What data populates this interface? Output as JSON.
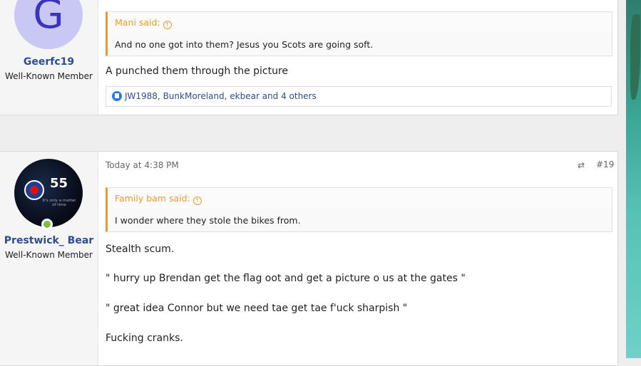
{
  "posts": [
    {
      "avatar_letter": "G",
      "username": "Geerfc19",
      "user_title": "Well-Known Member",
      "quote": {
        "author": "Mani said:",
        "text": "And no one got into them? Jesus you Scots are going soft."
      },
      "message": "A punched them through the picture",
      "reactions": "JW1988, BunkMoreland, ekbear and 4 others"
    },
    {
      "avatar_text": {
        "number": "55",
        "tagline": "It's only a matter of time"
      },
      "username": "Prestwick_ Bear",
      "user_title": "Well-Known Member",
      "date": "Today at 4:38 PM",
      "post_number": "#19",
      "quote": {
        "author": "Family bam said:",
        "text": "I wonder where they stole the bikes from."
      },
      "lines": [
        "Stealth scum.",
        "\" hurry up Brendan get the flag oot and get a picture o us at the gates \"",
        "\" great idea Connor but we need tae get tae f'uck sharpish \"",
        "Fucking cranks."
      ]
    }
  ],
  "colors": {
    "quote_accent": "#e69b2e",
    "username": "#2d4d8e",
    "online": "#7cbf3a"
  }
}
